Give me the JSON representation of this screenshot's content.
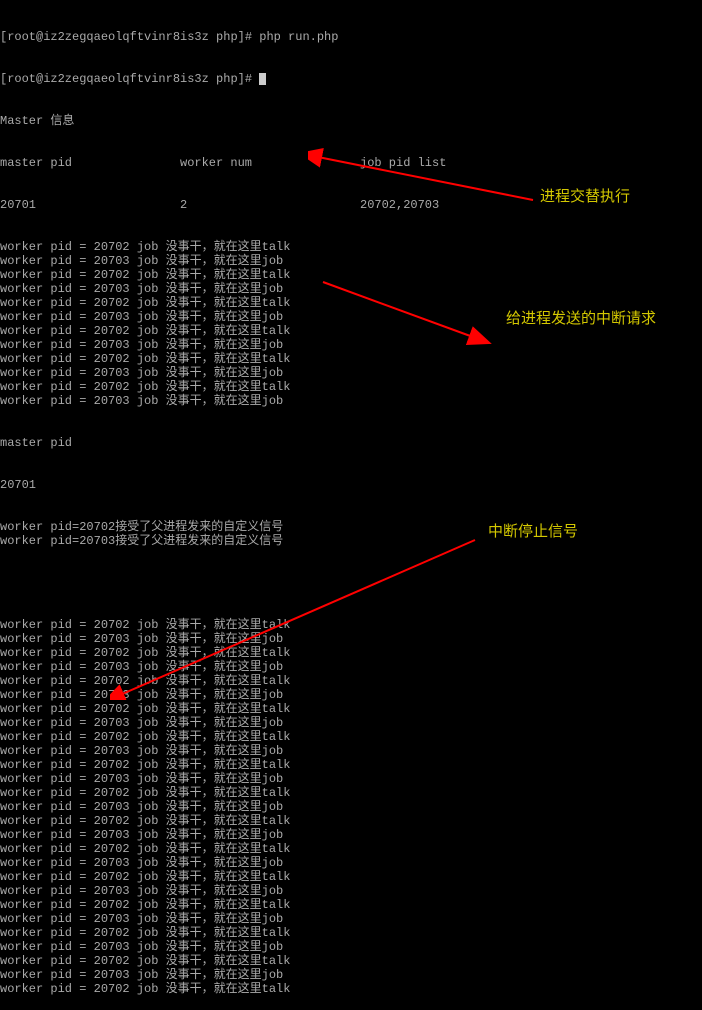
{
  "prompt1": "[root@iz2zegqaeolqftvinr8is3z php]# php run.php",
  "prompt2": "[root@iz2zegqaeolqftvinr8is3z php]# ",
  "master_label": "Master 信息",
  "headers": {
    "c1": "master pid",
    "c2": "worker num",
    "c3": "job pid list"
  },
  "master_row": {
    "c1": "20701",
    "c2": "2",
    "c3": "20702,20703"
  },
  "block1": [
    "worker pid = 20702 job 没事干，就在这里talk",
    "worker pid = 20703 job 没事干，就在这里job",
    "worker pid = 20702 job 没事干，就在这里talk",
    "worker pid = 20703 job 没事干，就在这里job",
    "worker pid = 20702 job 没事干，就在这里talk",
    "worker pid = 20703 job 没事干，就在这里job",
    "worker pid = 20702 job 没事干，就在这里talk",
    "worker pid = 20703 job 没事干，就在这里job",
    "worker pid = 20702 job 没事干，就在这里talk",
    "worker pid = 20703 job 没事干，就在这里job",
    "worker pid = 20702 job 没事干，就在这里talk",
    "worker pid = 20703 job 没事干，就在这里job"
  ],
  "master_pid_line1": "master pid",
  "master_pid_line2": "20701",
  "signal_lines": [
    "worker pid=20702接受了父进程发来的自定义信号",
    "worker pid=20703接受了父进程发来的自定义信号"
  ],
  "block2": [
    "worker pid = 20702 job 没事干，就在这里talk",
    "worker pid = 20703 job 没事干，就在这里job",
    "worker pid = 20702 job 没事干，就在这里talk",
    "worker pid = 20703 job 没事干，就在这里job",
    "worker pid = 20702 job 没事干，就在这里talk",
    "worker pid = 20703 job 没事干，就在这里job",
    "worker pid = 20702 job 没事干，就在这里talk",
    "worker pid = 20703 job 没事干，就在这里job",
    "worker pid = 20702 job 没事干，就在这里talk",
    "worker pid = 20703 job 没事干，就在这里job",
    "worker pid = 20702 job 没事干，就在这里talk",
    "worker pid = 20703 job 没事干，就在这里job",
    "worker pid = 20702 job 没事干，就在这里talk",
    "worker pid = 20703 job 没事干，就在这里job",
    "worker pid = 20702 job 没事干，就在这里talk",
    "worker pid = 20703 job 没事干，就在这里job",
    "worker pid = 20702 job 没事干，就在这里talk",
    "worker pid = 20703 job 没事干，就在这里job",
    "worker pid = 20702 job 没事干，就在这里talk",
    "worker pid = 20703 job 没事干，就在这里job",
    "worker pid = 20702 job 没事干，就在这里talk",
    "worker pid = 20703 job 没事干，就在这里job",
    "worker pid = 20702 job 没事干，就在这里talk",
    "worker pid = 20703 job 没事干，就在这里job",
    "worker pid = 20702 job 没事干，就在这里talk",
    "worker pid = 20703 job 没事干，就在这里job",
    "worker pid = 20702 job 没事干，就在这里talk"
  ],
  "annotations": {
    "a1": "进程交替执行",
    "a2": "给进程发送的中断请求",
    "a3": "中断停止信号"
  }
}
